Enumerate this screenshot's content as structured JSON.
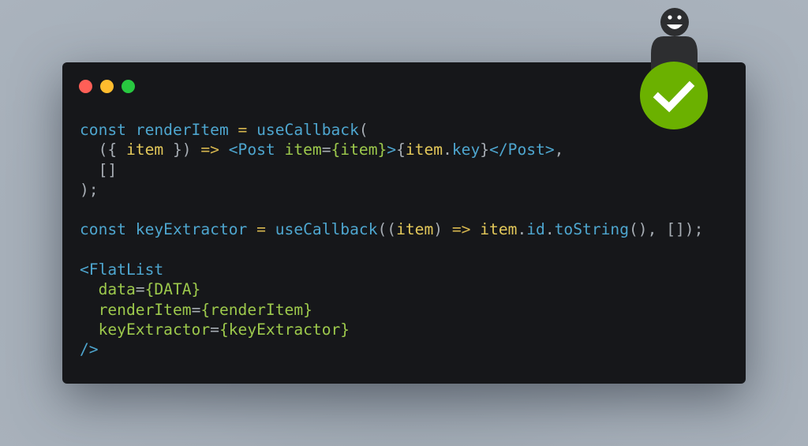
{
  "window": {
    "controls": [
      {
        "name": "close",
        "color": "#ff5f57"
      },
      {
        "name": "minimize",
        "color": "#febc2e"
      },
      {
        "name": "zoom",
        "color": "#28c840"
      }
    ]
  },
  "code": {
    "language": "jsx",
    "lines": [
      [
        {
          "t": "const ",
          "c": "kw"
        },
        {
          "t": "renderItem ",
          "c": "fn"
        },
        {
          "t": "=",
          "c": "op"
        },
        {
          "t": " useCallback",
          "c": "fn"
        },
        {
          "t": "(",
          "c": "pn"
        }
      ],
      [
        {
          "t": "  ({ ",
          "c": "pn"
        },
        {
          "t": "item",
          "c": "pm"
        },
        {
          "t": " }) ",
          "c": "pn"
        },
        {
          "t": "=>",
          "c": "op"
        },
        {
          "t": " <Post ",
          "c": "tag"
        },
        {
          "t": "item",
          "c": "attr"
        },
        {
          "t": "=",
          "c": "pn"
        },
        {
          "t": "{item}",
          "c": "attr"
        },
        {
          "t": ">",
          "c": "tag"
        },
        {
          "t": "{",
          "c": "pn"
        },
        {
          "t": "item",
          "c": "pm"
        },
        {
          "t": ".",
          "c": "pn"
        },
        {
          "t": "key",
          "c": "prop"
        },
        {
          "t": "}",
          "c": "pn"
        },
        {
          "t": "</Post>",
          "c": "tag"
        },
        {
          "t": ",",
          "c": "pn"
        }
      ],
      [
        {
          "t": "  []",
          "c": "pn"
        }
      ],
      [
        {
          "t": ");",
          "c": "pn"
        }
      ],
      [],
      [
        {
          "t": "const ",
          "c": "kw"
        },
        {
          "t": "keyExtractor ",
          "c": "fn"
        },
        {
          "t": "=",
          "c": "op"
        },
        {
          "t": " useCallback",
          "c": "fn"
        },
        {
          "t": "((",
          "c": "pn"
        },
        {
          "t": "item",
          "c": "pm"
        },
        {
          "t": ") ",
          "c": "pn"
        },
        {
          "t": "=>",
          "c": "op"
        },
        {
          "t": " item",
          "c": "pm"
        },
        {
          "t": ".",
          "c": "pn"
        },
        {
          "t": "id",
          "c": "prop"
        },
        {
          "t": ".",
          "c": "pn"
        },
        {
          "t": "toString",
          "c": "prop"
        },
        {
          "t": "(), []);",
          "c": "pn"
        }
      ],
      [],
      [
        {
          "t": "<FlatList",
          "c": "tag"
        }
      ],
      [
        {
          "t": "  data",
          "c": "attr"
        },
        {
          "t": "=",
          "c": "pn"
        },
        {
          "t": "{DATA}",
          "c": "attr"
        }
      ],
      [
        {
          "t": "  renderItem",
          "c": "attr"
        },
        {
          "t": "=",
          "c": "pn"
        },
        {
          "t": "{renderItem}",
          "c": "attr"
        }
      ],
      [
        {
          "t": "  keyExtractor",
          "c": "attr"
        },
        {
          "t": "=",
          "c": "pn"
        },
        {
          "t": "{keyExtractor}",
          "c": "attr"
        }
      ],
      [
        {
          "t": "/>",
          "c": "tag"
        }
      ]
    ]
  },
  "badge": {
    "icon": "checkmark-icon",
    "color": "#6bb100",
    "figure": "smiling-person-icon"
  }
}
